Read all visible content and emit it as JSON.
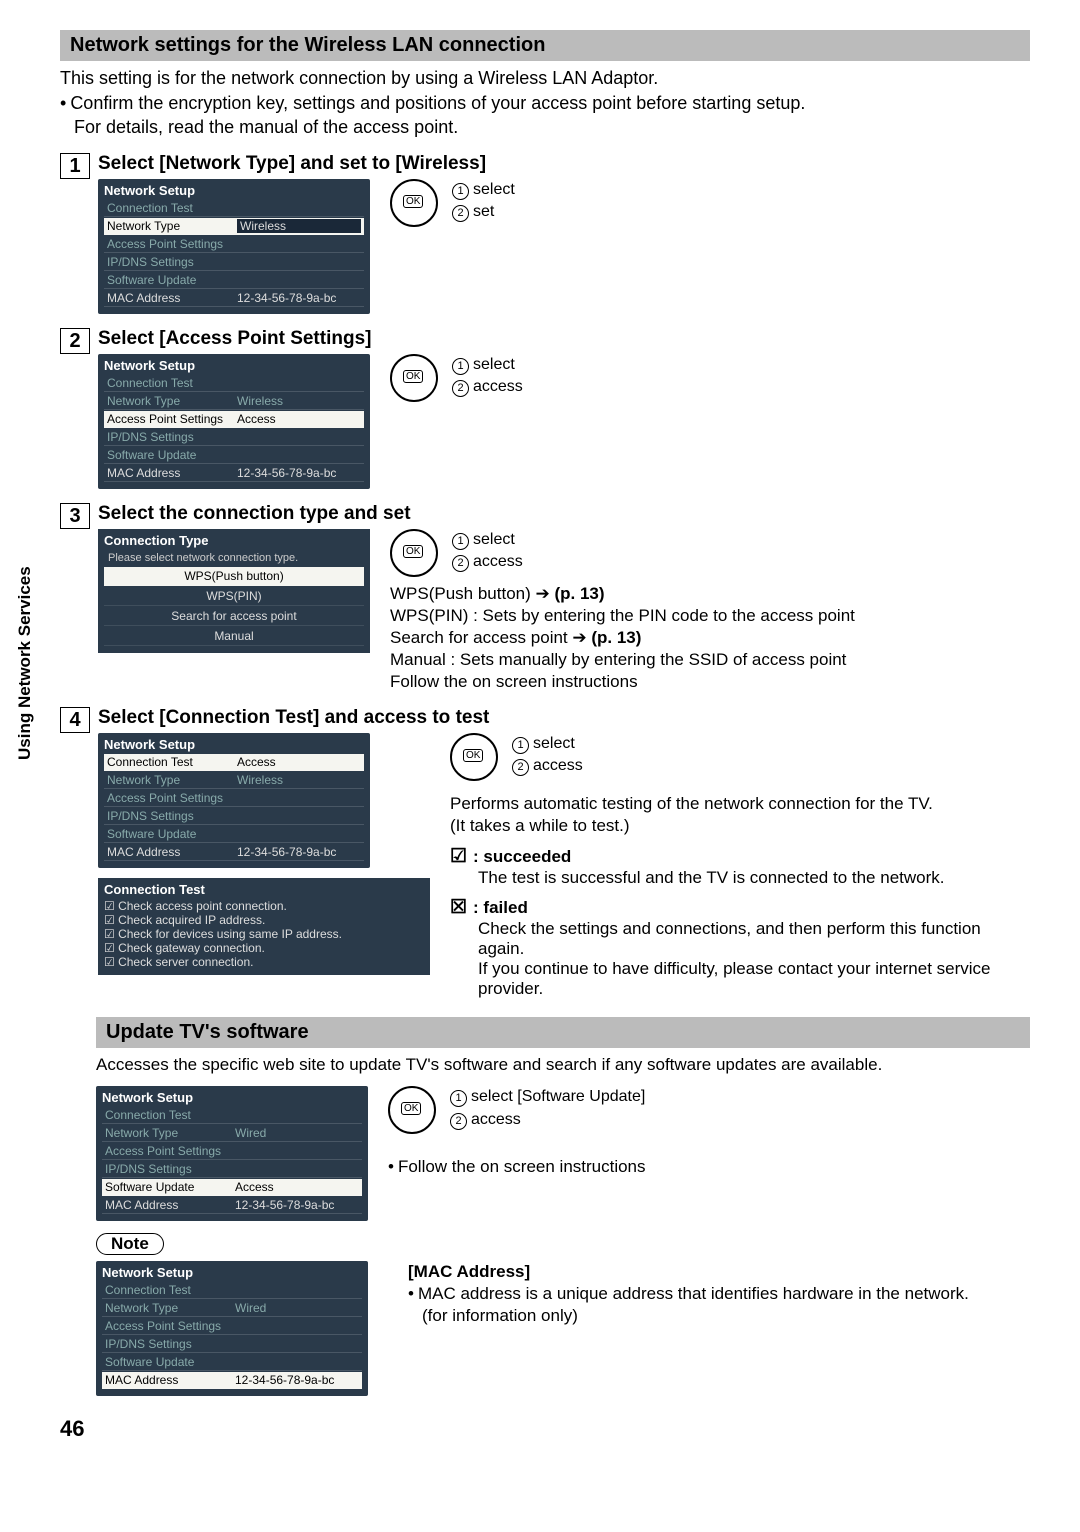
{
  "side_label": "Using Network Services",
  "section_header": "Network settings for the Wireless LAN connection",
  "intro": {
    "l1": "This setting is for the network connection by using a Wireless LAN Adaptor.",
    "l2": "Confirm the encryption key, settings and positions of your access point before starting setup.",
    "l3": "For details, read the manual of the access point."
  },
  "remote": {
    "select": "select",
    "set": "set",
    "access": "access"
  },
  "menu_common": {
    "title": "Network Setup",
    "rows": {
      "conn_test": "Connection Test",
      "net_type": "Network Type",
      "ap_settings": "Access Point Settings",
      "ipdns": "IP/DNS Settings",
      "sw_update": "Software Update",
      "mac": "MAC Address"
    },
    "values": {
      "wireless": "Wireless",
      "wired": "Wired",
      "access": "Access",
      "mac_val": "12-34-56-78-9a-bc"
    }
  },
  "step1": {
    "num": "1",
    "title": "Select [Network Type] and set to [Wireless]"
  },
  "step2": {
    "num": "2",
    "title": "Select [Access Point Settings]"
  },
  "step3": {
    "num": "3",
    "title": "Select the connection type and set",
    "menu_title": "Connection Type",
    "hint": "Please select network connection type.",
    "items": {
      "wps_push": "WPS(Push button)",
      "wps_pin": "WPS(PIN)",
      "search": "Search for access point",
      "manual": "Manual"
    },
    "desc": {
      "l1a": "WPS(Push button)",
      "l1b": "(p. 13)",
      "l2": "WPS(PIN) : Sets by entering the PIN code to the access point",
      "l3a": "Search for access point",
      "l3b": "(p. 13)",
      "l4": "Manual : Sets manually by entering the SSID of access point",
      "l5": "Follow the on screen instructions"
    }
  },
  "step4": {
    "num": "4",
    "title": "Select [Connection Test] and access to test",
    "desc1": "Performs automatic testing of the network connection for the TV.",
    "desc2": "(It takes a while to test.)",
    "test_title": "Connection Test",
    "tests": [
      "Check access point connection.",
      "Check acquired IP address.",
      "Check for devices using same IP address.",
      "Check gateway connection.",
      "Check server connection."
    ],
    "succ_label": ": succeeded",
    "succ_text": "The test is successful and the TV is connected to the network.",
    "fail_label": ": failed",
    "fail_text1": "Check the settings and connections, and then perform this function again.",
    "fail_text2": "If you continue to have difficulty, please contact your internet service provider."
  },
  "update": {
    "header": "Update TV's software",
    "intro": "Accesses the specific web site to update TV's software and search if any software updates are available.",
    "select_label": "select [Software Update]",
    "follow": "Follow the on screen instructions"
  },
  "note": {
    "label": "Note",
    "mac_title": "[MAC Address]",
    "mac_l1": "MAC address is a unique address that identifies hardware in the network.",
    "mac_l2": "(for information only)"
  },
  "page_number": "46"
}
